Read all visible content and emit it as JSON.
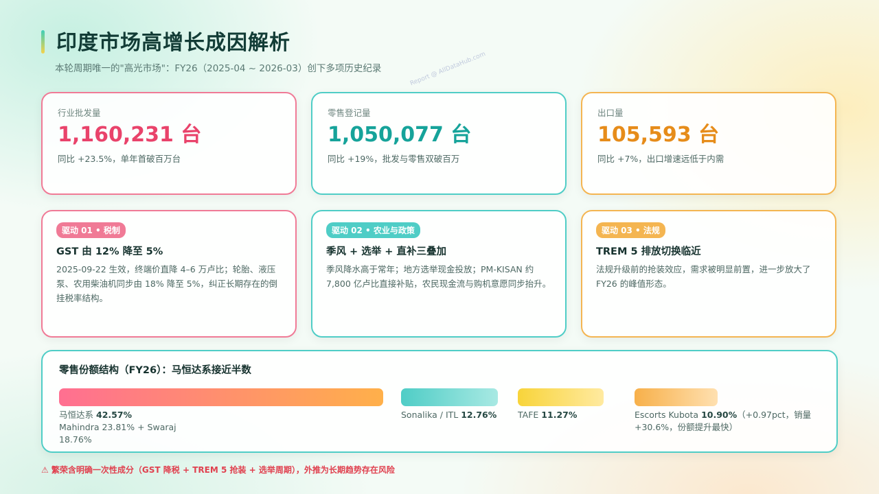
{
  "header": {
    "title": "印度市场高增长成因解析",
    "subtitle": "本轮周期唯一的\"高光市场\"：FY26（2025-04 ~ 2026-03）创下多项历史纪录"
  },
  "watermark": "Report @ AllDataHub.com",
  "stats": [
    {
      "label": "行业批发量",
      "value": "1,160,231 台",
      "note": "同比 +23.5%，单年首破百万台"
    },
    {
      "label": "零售登记量",
      "value": "1,050,077 台",
      "note": "同比 +19%，批发与零售双破百万"
    },
    {
      "label": "出口量",
      "value": "105,593 台",
      "note": "同比 +7%，出口增速远低于内需"
    }
  ],
  "drivers": [
    {
      "badge": "驱动 01 • 税制",
      "title": "GST 由 12% 降至 5%",
      "body": "2025-09-22 生效，终端价直降 4–6 万卢比；轮胎、液压泵、农用柴油机同步由 18% 降至 5%，纠正长期存在的倒挂税率结构。"
    },
    {
      "badge": "驱动 02 • 农业与政策",
      "title": "季风 + 选举 + 直补三叠加",
      "body": "季风降水高于常年；地方选举现金投放；PM-KISAN 约 7,800 亿卢比直接补贴，农民现金流与购机意愿同步抬升。"
    },
    {
      "badge": "驱动 03 • 法规",
      "title": "TREM 5 排放切换临近",
      "body": "法规升级前的抢装效应，需求被明显前置，进一步放大了 FY26 的峰值形态。"
    }
  ],
  "share": {
    "title": "零售份额结构（FY26）：马恒达系接近半数",
    "segments": [
      {
        "name": "马恒达系",
        "value": 42.57,
        "pct": "42.57%",
        "detail": "Mahindra 23.81% + Swaraj 18.76%",
        "color_start": "#ff6f91",
        "color_end": "#ffb04a"
      },
      {
        "name": "Sonalika / ITL",
        "value": 12.76,
        "pct": "12.76%",
        "detail": "",
        "color_start": "#4fcdc6",
        "color_end": "#a8e9e3"
      },
      {
        "name": "TAFE",
        "value": 11.27,
        "pct": "11.27%",
        "detail": "",
        "color_start": "#f8d43a",
        "color_end": "#ffeaa0"
      },
      {
        "name": "Escorts Kubota",
        "value": 10.9,
        "pct": "10.90%",
        "detail": "（+0.97pct，销量 +30.6%，份额提升最快）",
        "color_start": "#f7b04a",
        "color_end": "#ffe0b0"
      }
    ]
  },
  "footnote": "⚠ 繁荣含明确一次性成分（GST 降税 + TREM 5 抢装 + 选举周期），外推为长期趋势存在风险"
}
